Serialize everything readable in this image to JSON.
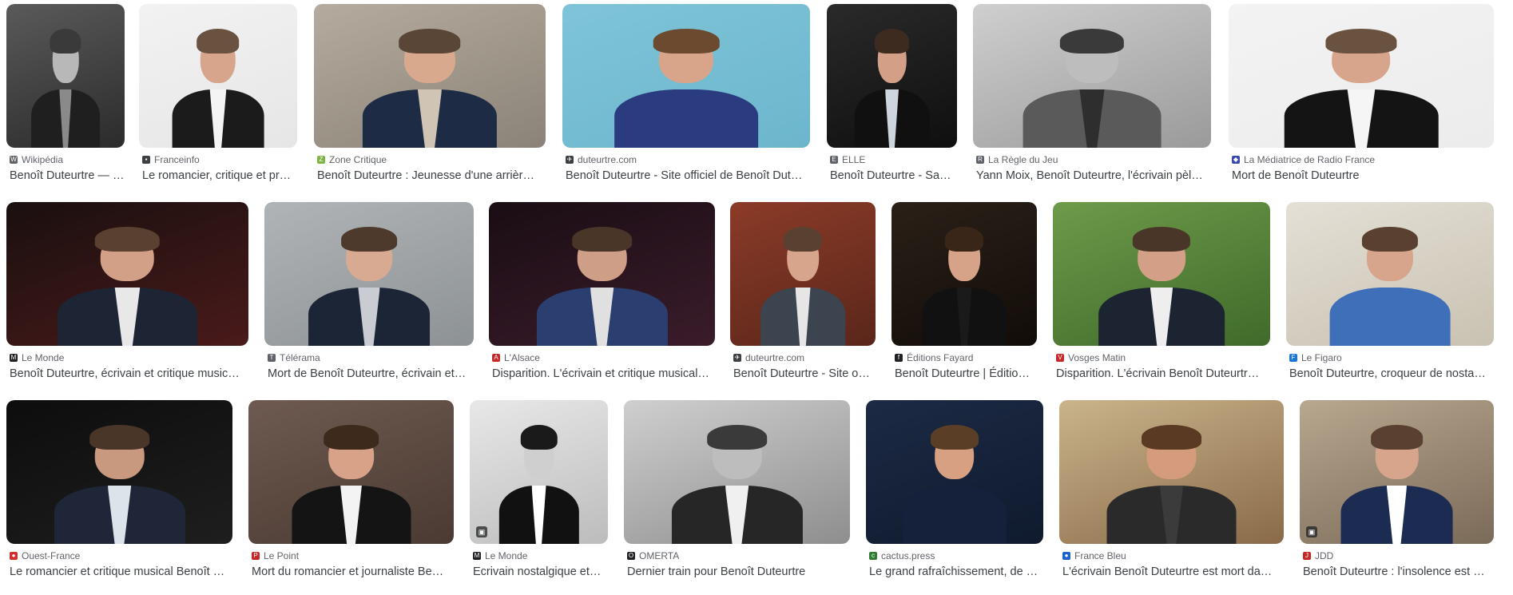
{
  "image_results": {
    "rows": [
      {
        "cards": [
          {
            "source": "Wikipédia",
            "caption": "Benoît Duteurtre — Wikipédia",
            "favicon_glyph": "W",
            "favicon_color": "#5f6368",
            "bg": "#5a5a5a",
            "bg2": "#2b2b2b",
            "jacket": "#1f1f1f",
            "shirt": "#8a8a8a",
            "skin": "#b8b8b8",
            "hair": "#3a3a3a"
          },
          {
            "source": "Franceinfo",
            "caption": "Le romancier, critique et pr…",
            "favicon_glyph": "▪",
            "favicon_color": "#3c4043",
            "bg": "#f2f2f2",
            "bg2": "#e6e6e6",
            "jacket": "#1b1b1b",
            "shirt": "#f4f4f4",
            "skin": "#d6a58c",
            "hair": "#6a5240"
          },
          {
            "source": "Zone Critique",
            "caption": "Benoît Duteurtre : Jeunesse d'une arrièr…",
            "favicon_glyph": "Z",
            "favicon_color": "#7cb342",
            "bg": "#b5ab9e",
            "bg2": "#8b8378",
            "jacket": "#1d2b45",
            "shirt": "#d0c4b4",
            "skin": "#d9a98e",
            "hair": "#5a4636"
          },
          {
            "source": "duteurtre.com",
            "caption": "Benoît Duteurtre - Site officiel de Benoît Dut…",
            "favicon_glyph": "✈",
            "favicon_color": "#3c4043",
            "bg": "#7fc4d8",
            "bg2": "#6cb6cc",
            "jacket": "#2b3b80",
            "shirt": "#2b3b80",
            "skin": "#d8a48a",
            "hair": "#6b4a2f"
          },
          {
            "source": "ELLE",
            "caption": "Benoît Duteurtre - Sa…",
            "favicon_glyph": "E",
            "favicon_color": "#5f6368",
            "bg": "#2a2a2a",
            "bg2": "#0f0f0f",
            "jacket": "#101010",
            "shirt": "#cfd5dd",
            "skin": "#d3a087",
            "hair": "#3e2b20"
          },
          {
            "source": "La Règle du Jeu",
            "caption": "Yann Moix, Benoît Duteurtre, l'écrivain pèl…",
            "favicon_glyph": "R",
            "favicon_color": "#5f6368",
            "bg": "#cfcfcf",
            "bg2": "#9a9a9a",
            "jacket": "#5a5a5a",
            "shirt": "#2e2e2e",
            "skin": "#bdbdbd",
            "hair": "#3a3a3a"
          },
          {
            "source": "La Médiatrice de Radio France",
            "caption": "Mort de Benoît Duteurtre",
            "favicon_glyph": "◆",
            "favicon_color": "#3949ab",
            "bg": "#f3f3f3",
            "bg2": "#ececec",
            "jacket": "#141414",
            "shirt": "#f5f5f5",
            "skin": "#d6a58c",
            "hair": "#6a5240"
          }
        ]
      },
      {
        "cards": [
          {
            "source": "Le Monde",
            "caption": "Benoît Duteurtre, écrivain et critique music…",
            "favicon_glyph": "M",
            "favicon_color": "#202124",
            "bg": "#1a0f0f",
            "bg2": "#4a1a1a",
            "jacket": "#1d2433",
            "shirt": "#e8e8e8",
            "skin": "#d2a086",
            "hair": "#5a4030"
          },
          {
            "source": "Télérama",
            "caption": "Mort de Benoît Duteurtre, écrivain et…",
            "favicon_glyph": "T",
            "favicon_color": "#5f6368",
            "bg": "#b0b4b6",
            "bg2": "#8d9295",
            "jacket": "#1b2536",
            "shirt": "#c9ccd2",
            "skin": "#d8aa92",
            "hair": "#4e3a2c"
          },
          {
            "source": "L'Alsace",
            "caption": "Disparition. L'écrivain et critique musical…",
            "favicon_glyph": "A",
            "favicon_color": "#c62828",
            "bg": "#1a0d14",
            "bg2": "#3a1c2a",
            "jacket": "#2a3f70",
            "shirt": "#e0e0e0",
            "skin": "#cf9e86",
            "hair": "#4a3628"
          },
          {
            "source": "duteurtre.com",
            "caption": "Benoît Duteurtre - Site o…",
            "favicon_glyph": "✈",
            "favicon_color": "#3c4043",
            "bg": "#8b3b28",
            "bg2": "#5a261a",
            "jacket": "#3c4450",
            "shirt": "#e6e6e6",
            "skin": "#d6a58c",
            "hair": "#5a4030"
          },
          {
            "source": "Éditions Fayard",
            "caption": "Benoît Duteurtre | Éditio…",
            "favicon_glyph": "f",
            "favicon_color": "#202124",
            "bg": "#2a2018",
            "bg2": "#120c08",
            "jacket": "#111111",
            "shirt": "#1a1a1a",
            "skin": "#d7a388",
            "hair": "#3a2618"
          },
          {
            "source": "Vosges Matin",
            "caption": "Disparition. L'écrivain Benoît Duteurtr…",
            "favicon_glyph": "V",
            "favicon_color": "#c62828",
            "bg": "#6e9a4a",
            "bg2": "#3f6a2a",
            "jacket": "#1c2431",
            "shirt": "#eeeeee",
            "skin": "#d3a087",
            "hair": "#4a3628"
          },
          {
            "source": "Le Figaro",
            "caption": "Benoît Duteurtre, croqueur de nosta…",
            "favicon_glyph": "F",
            "favicon_color": "#1976d2",
            "bg": "#e4e0d6",
            "bg2": "#c9c2b2",
            "jacket": "#3f6fb8",
            "shirt": "#3f6fb8",
            "skin": "#d6a58c",
            "hair": "#5a4030"
          }
        ]
      },
      {
        "cards": [
          {
            "source": "Ouest-France",
            "caption": "Le romancier et critique musical Benoît …",
            "favicon_glyph": "●",
            "favicon_color": "#d32f2f",
            "bg": "#0d0d0d",
            "bg2": "#1e1e1e",
            "jacket": "#1e2638",
            "shirt": "#dde3ea",
            "skin": "#c9997f",
            "hair": "#4a3628"
          },
          {
            "source": "Le Point",
            "caption": "Mort du romancier et journaliste Be…",
            "favicon_glyph": "P",
            "favicon_color": "#c62828",
            "bg": "#6e5a50",
            "bg2": "#4a3a32",
            "jacket": "#141414",
            "shirt": "#f3f3f3",
            "skin": "#d7a288",
            "hair": "#3e2a1c"
          },
          {
            "source": "Le Monde",
            "caption": "Ecrivain nostalgique et…",
            "favicon_glyph": "M",
            "favicon_color": "#202124",
            "bg": "#e8e8e8",
            "bg2": "#bcbcbc",
            "jacket": "#111111",
            "shirt": "#ffffff",
            "skin": "#cfcfcf",
            "hair": "#1a1a1a"
          },
          {
            "source": "OMERTA",
            "caption": "Dernier train pour Benoît Duteurtre",
            "favicon_glyph": "O",
            "favicon_color": "#202124",
            "bg": "#cfcfcf",
            "bg2": "#8e8e8e",
            "jacket": "#262626",
            "shirt": "#f0f0f0",
            "skin": "#bdbdbd",
            "hair": "#3a3a3a"
          },
          {
            "source": "cactus.press",
            "caption": "Le grand rafraîchissement, de …",
            "favicon_glyph": "c",
            "favicon_color": "#2e7d32",
            "bg": "#1c2a44",
            "bg2": "#0f1a2e",
            "jacket": "#15213a",
            "shirt": "#15213a",
            "skin": "#d7a082",
            "hair": "#5a3e26"
          },
          {
            "source": "France Bleu",
            "caption": "L'écrivain Benoît Duteurtre est mort da…",
            "favicon_glyph": "●",
            "favicon_color": "#1e63c9",
            "bg": "#c9b48c",
            "bg2": "#8a6a48",
            "jacket": "#2a2a2a",
            "shirt": "#3b3b3b",
            "skin": "#d49c7c",
            "hair": "#5a3a22"
          },
          {
            "source": "JDD",
            "caption": "Benoît Duteurtre : l'insolence est …",
            "favicon_glyph": "J",
            "favicon_color": "#c62828",
            "bg": "#b8a890",
            "bg2": "#7a6a58",
            "jacket": "#1c2b52",
            "shirt": "#ffffff",
            "skin": "#d7a58c",
            "hair": "#5a4030"
          }
        ]
      }
    ]
  }
}
